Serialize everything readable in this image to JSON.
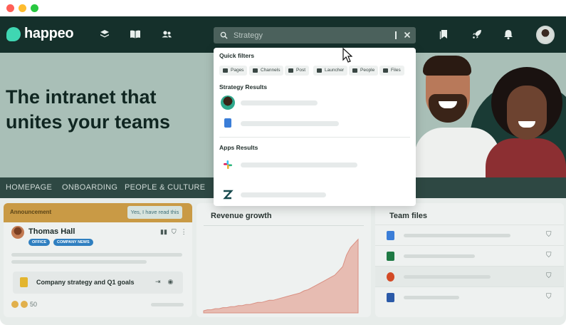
{
  "brand": {
    "name": "happeo",
    "accent": "#3fd6b2",
    "nav_bg": "#15302b"
  },
  "topnav": {
    "left_icons": [
      "layers-icon",
      "book-icon",
      "people-icon"
    ],
    "right_icons": [
      "bookmarks-icon",
      "rocket-icon",
      "bell-icon"
    ],
    "search": {
      "value": "Strategy",
      "clear_icon": "close-icon"
    }
  },
  "hero": {
    "title_line1": "The intranet that",
    "title_line2": "unites your teams"
  },
  "subnav": {
    "items": [
      "HOMEPAGE",
      "ONBOARDING",
      "PEOPLE & CULTURE"
    ]
  },
  "search_dropdown": {
    "quick_filters_label": "Quick filters",
    "filters": [
      "Pages",
      "Channels",
      "Post",
      "Launcher",
      "People",
      "Files"
    ],
    "strategy_results_label": "Strategy Results",
    "apps_results_label": "Apps Results",
    "app_icons": [
      "slack-icon",
      "zendesk-icon"
    ]
  },
  "announcement": {
    "label": "Announcement",
    "read_button": "Yes, I have read this",
    "author": "Thomas Hall",
    "tags": [
      "OFFICE",
      "COMPANY NEWS"
    ],
    "doc_title": "Company strategy and Q1 goals",
    "reaction_count": "50"
  },
  "revenue": {
    "title": "Revenue growth"
  },
  "chart_data": {
    "type": "area",
    "title": "Revenue growth",
    "xlabel": "",
    "ylabel": "",
    "y": [
      2,
      3,
      3,
      4,
      4,
      5,
      5,
      6,
      6,
      7,
      7,
      8,
      8,
      9,
      10,
      10,
      11,
      12,
      12,
      13,
      14,
      15,
      16,
      17,
      18,
      19,
      21,
      22,
      24,
      26,
      28,
      30,
      32,
      34,
      36,
      40,
      44,
      55,
      62,
      66,
      70
    ],
    "ylim": [
      0,
      80
    ],
    "grid": false,
    "legend": "none",
    "color": "#e7bcb2"
  },
  "team_files": {
    "title": "Team files",
    "files": [
      {
        "icon": "google-docs-icon",
        "color": "#3b7ed8"
      },
      {
        "icon": "excel-icon",
        "color": "#1f7a44"
      },
      {
        "icon": "powerpoint-icon",
        "color": "#d34a26"
      },
      {
        "icon": "word-icon",
        "color": "#2b5aa8"
      }
    ]
  }
}
